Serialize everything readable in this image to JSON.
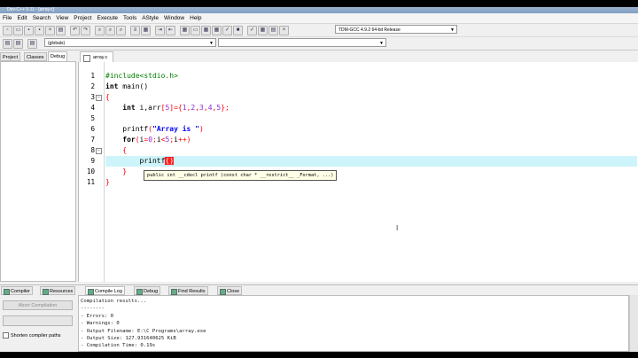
{
  "window": {
    "title": "Dev-C++ 5.11 - [array.c]"
  },
  "menu": [
    "File",
    "Edit",
    "Search",
    "View",
    "Project",
    "Execute",
    "Tools",
    "AStyle",
    "Window",
    "Help"
  ],
  "toolbar": {
    "compiler_select": "TDM-GCC 4.9.2 64-bit Release",
    "globals_select": "(globals)",
    "members_select": ""
  },
  "left_tabs": [
    "Project",
    "Classes",
    "Debug"
  ],
  "editor": {
    "tab_label": "array.c",
    "line_numbers": [
      "1",
      "2",
      "3",
      "4",
      "5",
      "6",
      "7",
      "8",
      "9",
      "10",
      "11"
    ],
    "lines": [
      {
        "indent": "",
        "tokens": [
          {
            "c": "pp",
            "t": "#include<stdio.h>"
          }
        ]
      },
      {
        "indent": "",
        "tokens": [
          {
            "c": "kw",
            "t": "int"
          },
          {
            "c": "fn",
            "t": " main()"
          }
        ]
      },
      {
        "indent": "",
        "tokens": [
          {
            "c": "pu",
            "t": "{"
          }
        ]
      },
      {
        "indent": "    ",
        "tokens": [
          {
            "c": "kw",
            "t": "int"
          },
          {
            "c": "fn",
            "t": " i,arr"
          },
          {
            "c": "pu",
            "t": "["
          },
          {
            "c": "nm",
            "t": "5"
          },
          {
            "c": "pu",
            "t": "]={"
          },
          {
            "c": "nm",
            "t": "1"
          },
          {
            "c": "pu",
            "t": ","
          },
          {
            "c": "nm",
            "t": "2"
          },
          {
            "c": "pu",
            "t": ","
          },
          {
            "c": "nm",
            "t": "3"
          },
          {
            "c": "pu",
            "t": ","
          },
          {
            "c": "nm",
            "t": "4"
          },
          {
            "c": "pu",
            "t": ","
          },
          {
            "c": "nm",
            "t": "5"
          },
          {
            "c": "pu",
            "t": "};"
          }
        ]
      },
      {
        "indent": "",
        "tokens": []
      },
      {
        "indent": "    ",
        "tokens": [
          {
            "c": "fn",
            "t": "printf"
          },
          {
            "c": "pu",
            "t": "("
          },
          {
            "c": "st",
            "t": "\"Array is \""
          },
          {
            "c": "pu",
            "t": ")"
          }
        ]
      },
      {
        "indent": "    ",
        "tokens": [
          {
            "c": "kw",
            "t": "for"
          },
          {
            "c": "pu",
            "t": "("
          },
          {
            "c": "fn",
            "t": "i"
          },
          {
            "c": "pu",
            "t": "="
          },
          {
            "c": "nm",
            "t": "0"
          },
          {
            "c": "pu",
            "t": ";"
          },
          {
            "c": "fn",
            "t": "i"
          },
          {
            "c": "pu",
            "t": "<"
          },
          {
            "c": "nm",
            "t": "5"
          },
          {
            "c": "pu",
            "t": ";"
          },
          {
            "c": "fn",
            "t": "i"
          },
          {
            "c": "pu",
            "t": "++)"
          }
        ]
      },
      {
        "indent": "    ",
        "tokens": [
          {
            "c": "pu",
            "t": "{"
          }
        ]
      },
      {
        "indent": "        ",
        "tokens": [
          {
            "c": "fn",
            "t": "printf"
          },
          {
            "c": "cur",
            "t": "()"
          }
        ]
      },
      {
        "indent": "    ",
        "tokens": [
          {
            "c": "pu",
            "t": "}"
          }
        ]
      },
      {
        "indent": "",
        "tokens": [
          {
            "c": "pu",
            "t": "}"
          }
        ]
      }
    ],
    "tooltip": "public int __cdecl printf (const char * __restrict__ _Format, ...)"
  },
  "bottom_tabs": [
    "Compiler",
    "Resources",
    "Compile Log",
    "Debug",
    "Find Results",
    "Close"
  ],
  "bottom": {
    "abort_label": "Abort Compilation",
    "shorten_label": "Shorten compiler paths",
    "log_lines": [
      "Compilation results...",
      "--------",
      "- Errors: 0",
      "- Warnings: 0",
      "- Output Filename: E:\\C Programs\\array.exe",
      "- Output Size: 127.931640625 KiB",
      "- Compilation Time: 0.19s"
    ]
  }
}
